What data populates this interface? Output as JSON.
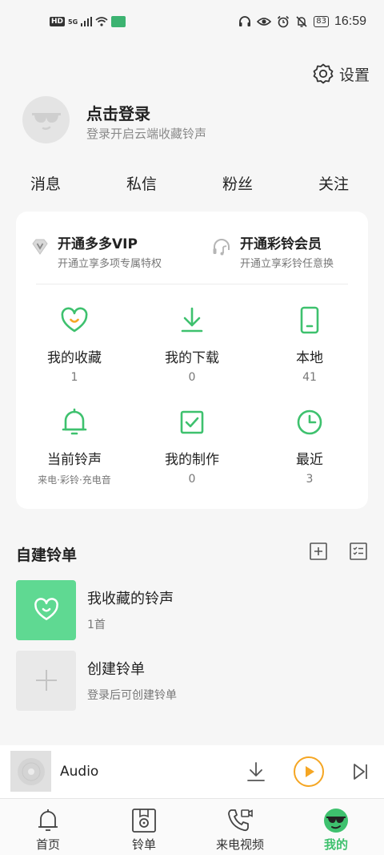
{
  "status_bar": {
    "hd_badge": "HD",
    "network": "5G",
    "battery": "83",
    "time": "16:59"
  },
  "settings": {
    "label": "设置"
  },
  "profile": {
    "title": "点击登录",
    "subtitle": "登录开启云端收藏铃声"
  },
  "social": [
    {
      "label": "消息"
    },
    {
      "label": "私信"
    },
    {
      "label": "粉丝"
    },
    {
      "label": "关注"
    }
  ],
  "vip": [
    {
      "title": "开通多多VIP",
      "subtitle": "开通立享多项专属特权"
    },
    {
      "title": "开通彩铃会员",
      "subtitle": "开通立享彩铃任意换"
    }
  ],
  "grid": [
    {
      "label": "我的收藏",
      "value": "1",
      "icon": "heart-icon"
    },
    {
      "label": "我的下载",
      "value": "0",
      "icon": "download-icon"
    },
    {
      "label": "本地",
      "value": "41",
      "icon": "phone-icon"
    },
    {
      "label": "当前铃声",
      "value": "来电·彩铃·充电音",
      "icon": "bell-icon"
    },
    {
      "label": "我的制作",
      "value": "0",
      "icon": "check-square-icon"
    },
    {
      "label": "最近",
      "value": "3",
      "icon": "clock-icon"
    }
  ],
  "playlists_section": {
    "title": "自建铃单"
  },
  "playlists": [
    {
      "name": "我收藏的铃声",
      "sub": "1首"
    },
    {
      "name": "创建铃单",
      "sub": "登录后可创建铃单"
    }
  ],
  "player": {
    "title": "Audio"
  },
  "tabs": [
    {
      "label": "首页"
    },
    {
      "label": "铃单"
    },
    {
      "label": "来电视频"
    },
    {
      "label": "我的"
    }
  ],
  "colors": {
    "accent": "#3ec16e",
    "play": "#f5a623"
  }
}
